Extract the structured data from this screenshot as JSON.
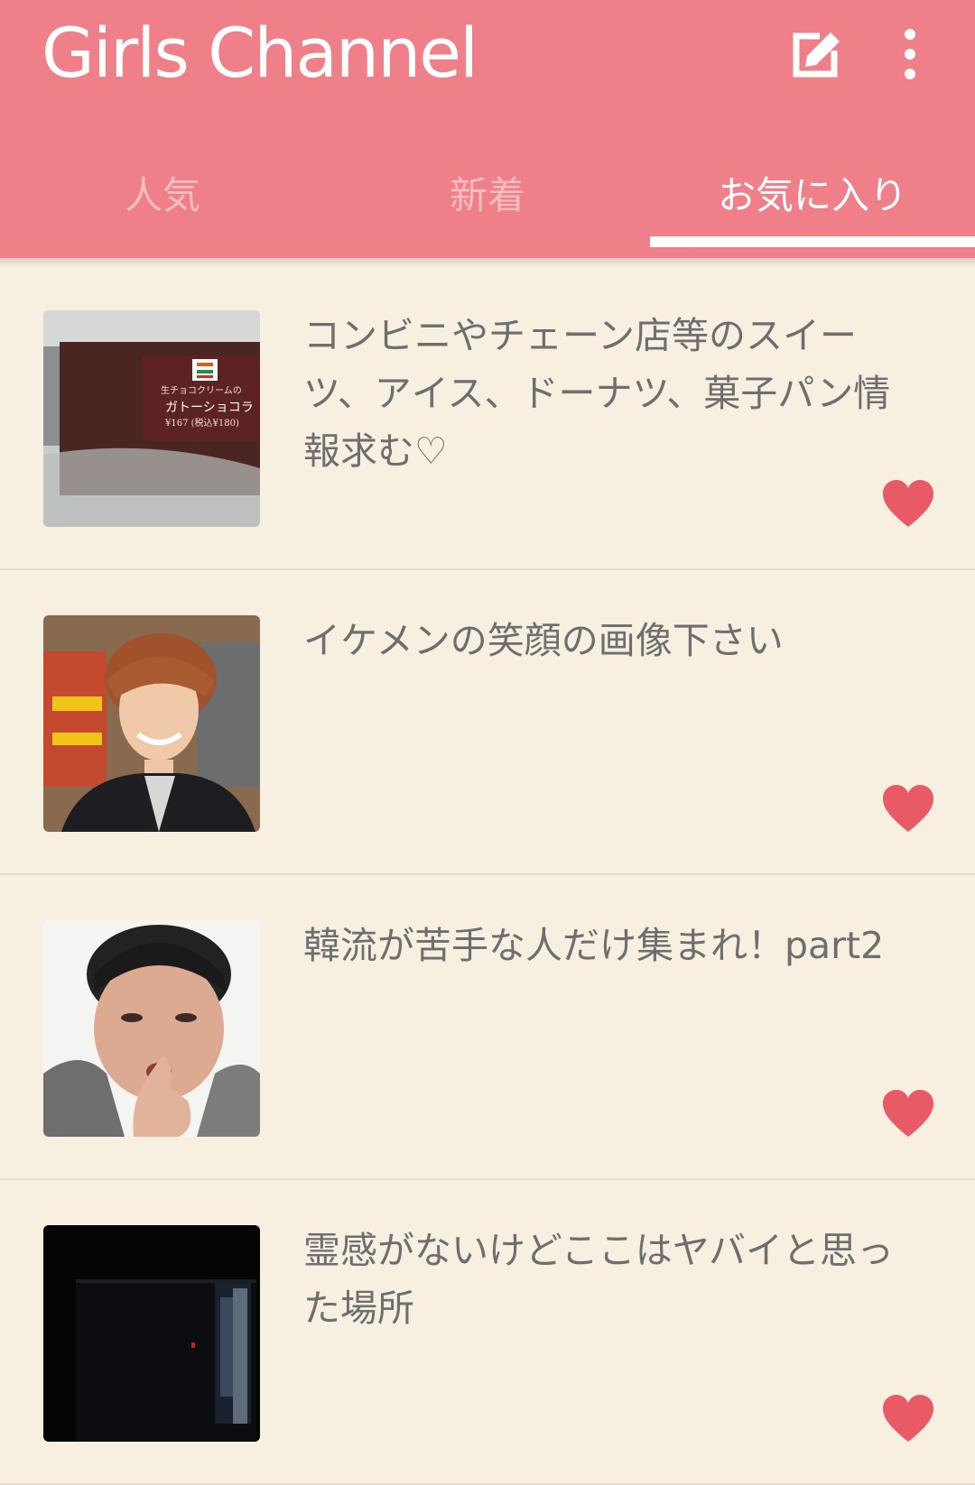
{
  "header": {
    "title": "Girls Channel",
    "compose_icon": "compose-icon",
    "more_icon": "more-vert-icon",
    "bg_color": "#ef7f88"
  },
  "tabs": [
    {
      "label": "人気",
      "active": false
    },
    {
      "label": "新着",
      "active": false
    },
    {
      "label": "お気に入り",
      "active": true
    }
  ],
  "topics": [
    {
      "title": "コンビニやチェーン店等のスイーツ、アイス、ドーナツ、菓子パン情報求む♡",
      "favorited": true,
      "thumbnail": "convenience-store-chocolate-cake",
      "thumbnail_text": [
        "生チョコクリームの",
        "ガトーショコラ",
        "¥167 (税込¥180)"
      ]
    },
    {
      "title": "イケメンの笑顔の画像下さい",
      "favorited": true,
      "thumbnail": "smiling-man-photo"
    },
    {
      "title": "韓流が苦手な人だけ集まれ！part2",
      "favorited": true,
      "thumbnail": "woman-pointing-photo"
    },
    {
      "title": "霊感がないけどここはヤバイと思った場所",
      "favorited": true,
      "thumbnail": "dark-corridor-photo"
    }
  ],
  "colors": {
    "background": "#f7f0e1",
    "heart": "#e85a66",
    "text": "#6e6e6e"
  }
}
